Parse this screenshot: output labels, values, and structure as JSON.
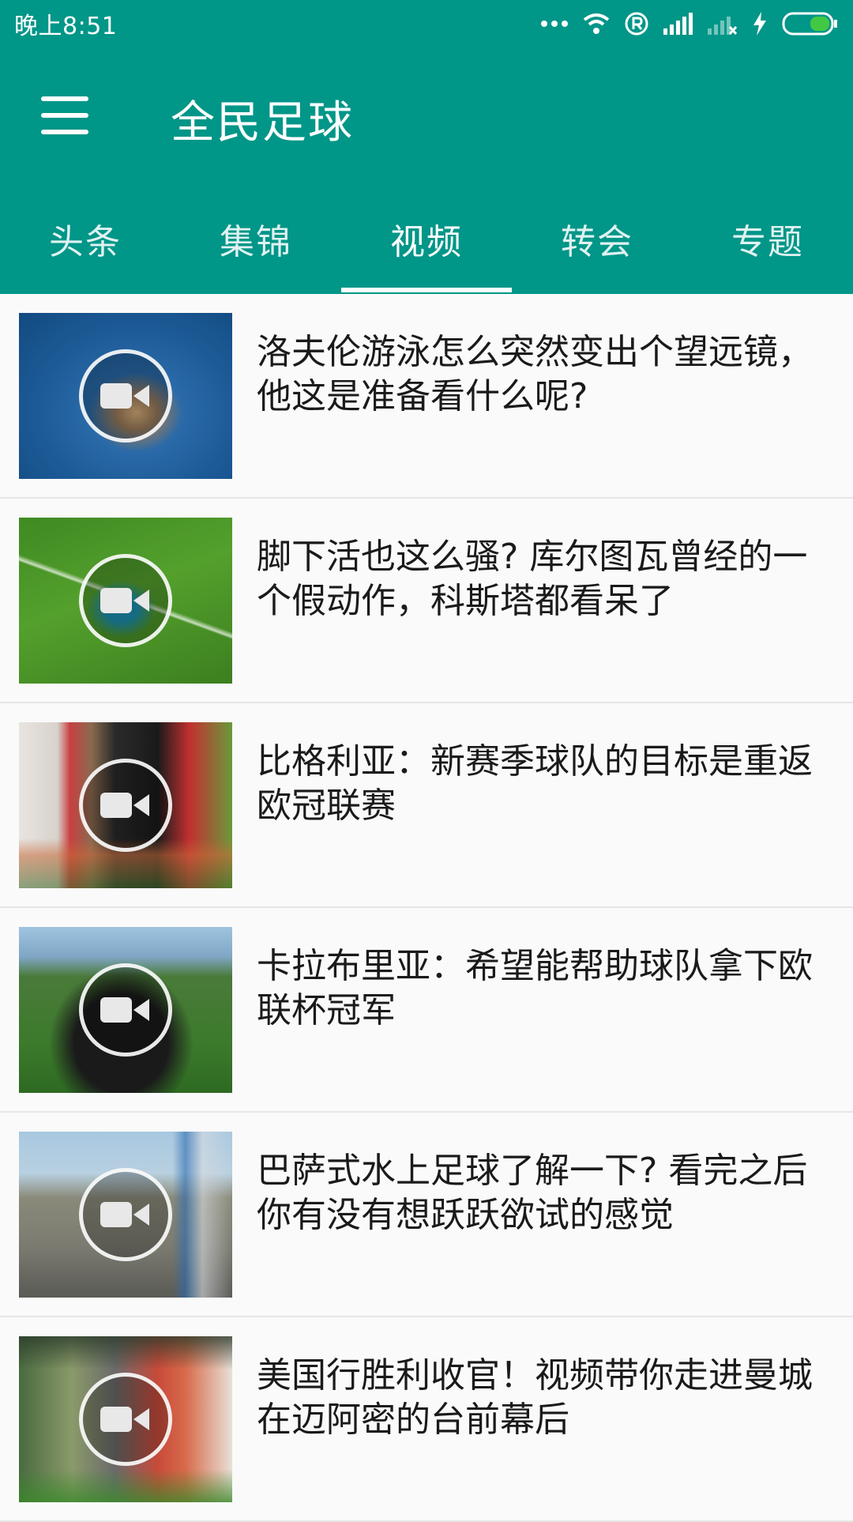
{
  "status_bar": {
    "time": "晚上8:51",
    "icons": [
      "more-dots-icon",
      "wifi-icon",
      "registered-icon",
      "signal-icon",
      "signal-no-sim-icon",
      "charging-icon",
      "battery-icon"
    ]
  },
  "app_bar": {
    "title": "全民足球",
    "menu_icon": "menu-icon"
  },
  "tabs": [
    {
      "label": "头条",
      "active": false
    },
    {
      "label": "集锦",
      "active": false
    },
    {
      "label": "视频",
      "active": true
    },
    {
      "label": "转会",
      "active": false
    },
    {
      "label": "专题",
      "active": false
    }
  ],
  "colors": {
    "primary": "#009688",
    "background": "#fafafa",
    "text": "#1a1a1a",
    "divider": "#e6e6e6"
  },
  "videos": [
    {
      "title": "洛夫伦游泳怎么突然变出个望远镜，他这是准备看什么呢?"
    },
    {
      "title": "脚下活也这么骚? 库尔图瓦曾经的一个假动作，科斯塔都看呆了"
    },
    {
      "title": "比格利亚：新赛季球队的目标是重返欧冠联赛"
    },
    {
      "title": "卡拉布里亚：希望能帮助球队拿下欧联杯冠军"
    },
    {
      "title": "巴萨式水上足球了解一下? 看完之后你有没有想跃跃欲试的感觉"
    },
    {
      "title": "美国行胜利收官！视频带你走进曼城在迈阿密的台前幕后"
    }
  ]
}
